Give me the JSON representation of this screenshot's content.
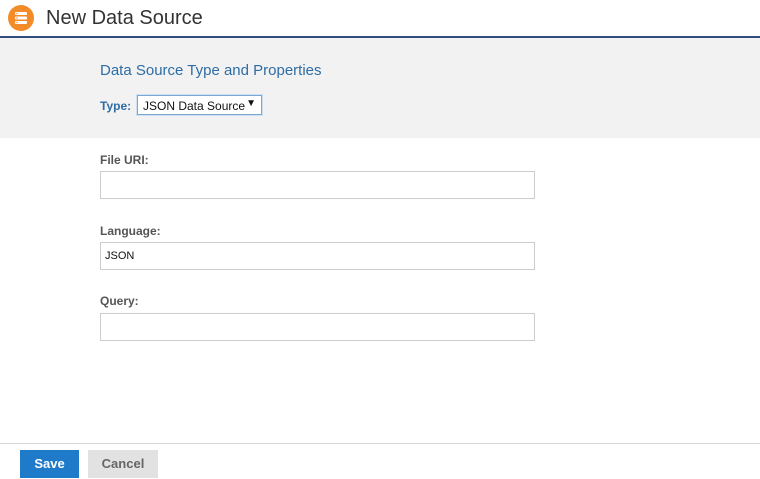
{
  "header": {
    "title": "New Data Source",
    "icon": "data-source-icon",
    "accent_color": "#f28b28"
  },
  "properties": {
    "heading": "Data Source Type and Properties",
    "type_label": "Type:",
    "type_value": "JSON Data Source"
  },
  "fields": {
    "file_uri": {
      "label": "File URI:",
      "value": ""
    },
    "language": {
      "label": "Language:",
      "value": "JSON"
    },
    "query": {
      "label": "Query:",
      "value": ""
    }
  },
  "footer": {
    "save_label": "Save",
    "cancel_label": "Cancel"
  }
}
